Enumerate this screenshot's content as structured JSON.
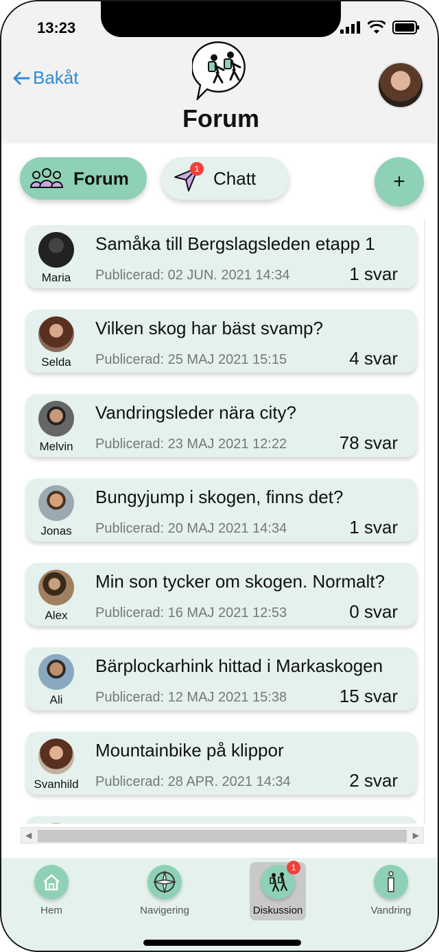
{
  "status_bar": {
    "time": "13:23"
  },
  "header": {
    "back_label": "Bakåt",
    "title": "Forum"
  },
  "segments": {
    "forum_label": "Forum",
    "chat_label": "Chatt",
    "chat_badge": "1",
    "add_label": "+"
  },
  "posts": [
    {
      "author": "Maria",
      "title": "Samåka till Bergslagsleden etapp 1",
      "published": "Publicerad: 02 JUN. 2021 14:34",
      "replies": "1 svar",
      "color": "#2b2b2b"
    },
    {
      "author": "Selda",
      "title": "Vilken skog har bäst svamp?",
      "published": "Publicerad: 25 MAJ 2021 15:15",
      "replies": "4 svar",
      "color": "#6b3b2a"
    },
    {
      "author": "Melvin",
      "title": "Vandringsleder nära city?",
      "published": "Publicerad: 23 MAJ 2021 12:22",
      "replies": "78 svar",
      "color": "#3c3c3c"
    },
    {
      "author": "Jonas",
      "title": "Bungyjump i skogen, finns det?",
      "published": "Publicerad: 20 MAJ 2021 14:34",
      "replies": "1 svar",
      "color": "#8a6a4a"
    },
    {
      "author": "Alex",
      "title": "Min son tycker om skogen. Normalt?",
      "published": "Publicerad: 16 MAJ 2021 12:53",
      "replies": "0 svar",
      "color": "#7a5a3a"
    },
    {
      "author": "Ali",
      "title": "Bärplockarhink hittad i Markaskogen",
      "published": "Publicerad: 12 MAJ 2021 15:38",
      "replies": "15 svar",
      "color": "#6a7a8a"
    },
    {
      "author": "Svanhild",
      "title": "Mountainbike på klippor",
      "published": "Publicerad: 28 APR. 2021 14:34",
      "replies": "2 svar",
      "color": "#5a3a2a"
    }
  ],
  "tabbar": {
    "home": "Hem",
    "navigation": "Navigering",
    "discussion": "Diskussion",
    "discussion_badge": "1",
    "hiking": "Vandring"
  }
}
